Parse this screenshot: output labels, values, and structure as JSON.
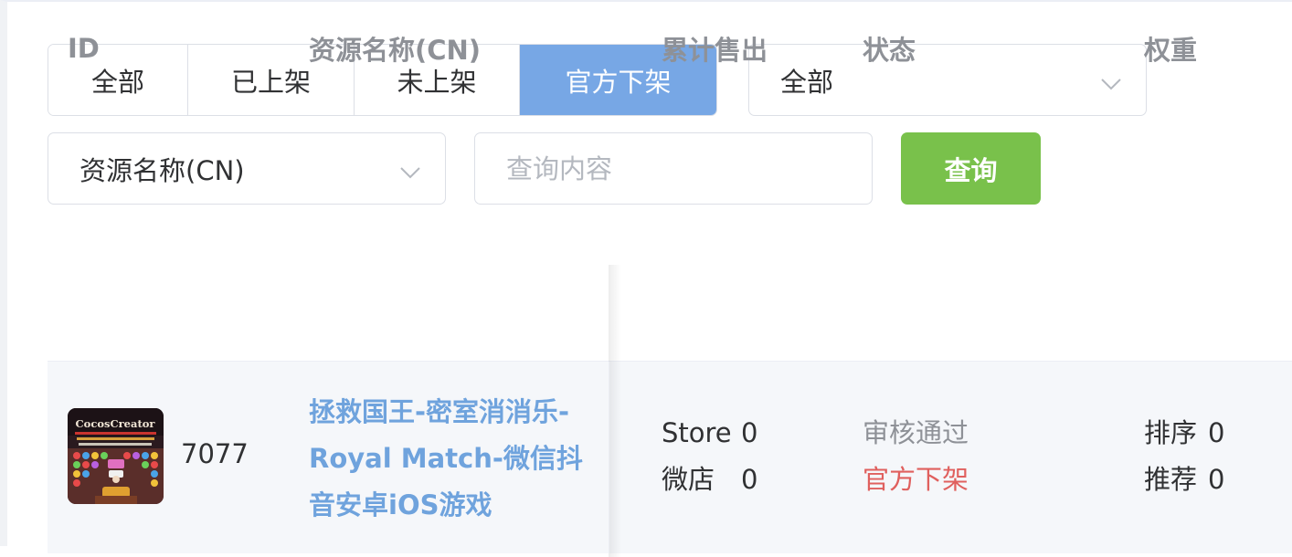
{
  "filters": {
    "tabs": [
      "全部",
      "已上架",
      "未上架",
      "官方下架"
    ],
    "active_tab": "官方下架",
    "status_select": "全部",
    "field_select": "资源名称(CN)",
    "search_placeholder": "查询内容",
    "search_value": "",
    "query_button": "查询"
  },
  "table": {
    "headers": {
      "id": "ID",
      "name": "资源名称(CN)",
      "sold": "累计售出",
      "status": "状态",
      "weight": "权重"
    },
    "rows": [
      {
        "thumb_text": "CocosCreator",
        "id": "7077",
        "name": "拯救国王-密室消消乐-Royal Match-微信抖音安卓iOS游戏",
        "name_lines": [
          "拯救国王-密室消消乐-",
          "Royal Match-微信抖",
          "音安卓iOS游戏"
        ],
        "sold": {
          "store_label": "Store",
          "store_value": "0",
          "weidian_label": "微店",
          "weidian_value": "0"
        },
        "status": {
          "review": "审核通过",
          "listing": "官方下架"
        },
        "weight": {
          "sort_label": "排序",
          "sort_value": "0",
          "recommend_label": "推荐",
          "recommend_value": "0"
        }
      }
    ]
  },
  "colors": {
    "active_tab": "#77a7e5",
    "query_button": "#79c14b",
    "link": "#6fa3dd",
    "status_red": "#e0605e",
    "status_gray": "#8e9197"
  }
}
